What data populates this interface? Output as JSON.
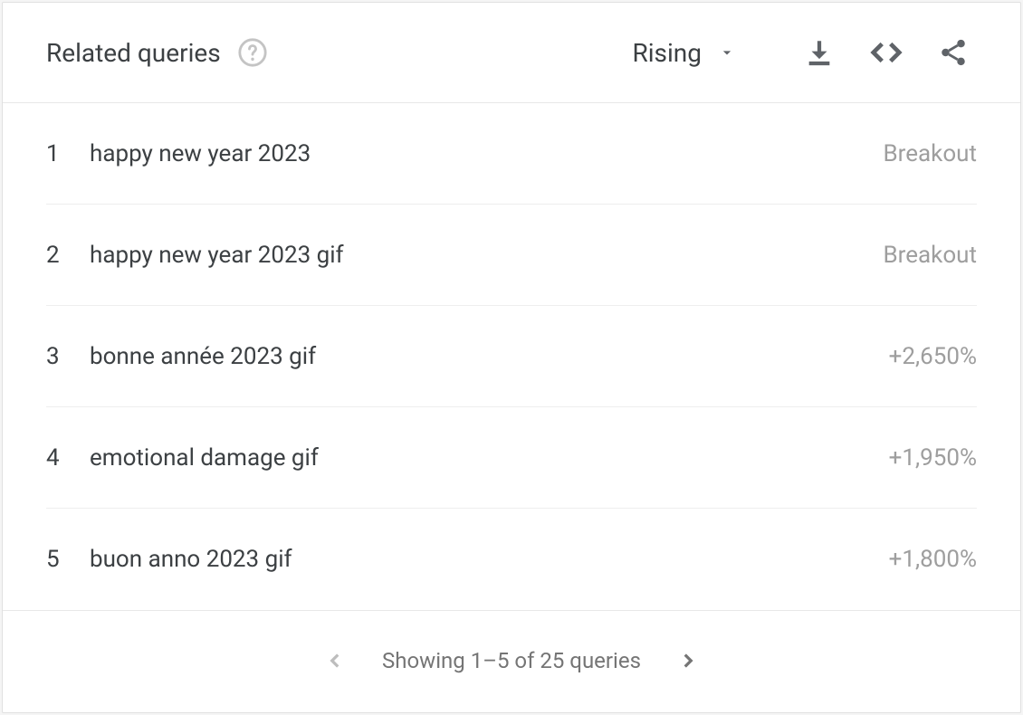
{
  "header": {
    "title": "Related queries",
    "sort": "Rising"
  },
  "rows": [
    {
      "rank": "1",
      "query": "happy new year 2023",
      "value": "Breakout"
    },
    {
      "rank": "2",
      "query": "happy new year 2023 gif",
      "value": "Breakout"
    },
    {
      "rank": "3",
      "query": "bonne année 2023 gif",
      "value": "+2,650%"
    },
    {
      "rank": "4",
      "query": "emotional damage gif",
      "value": "+1,950%"
    },
    {
      "rank": "5",
      "query": "buon anno 2023 gif",
      "value": "+1,800%"
    }
  ],
  "footer": {
    "text": "Showing 1–5 of 25 queries"
  }
}
